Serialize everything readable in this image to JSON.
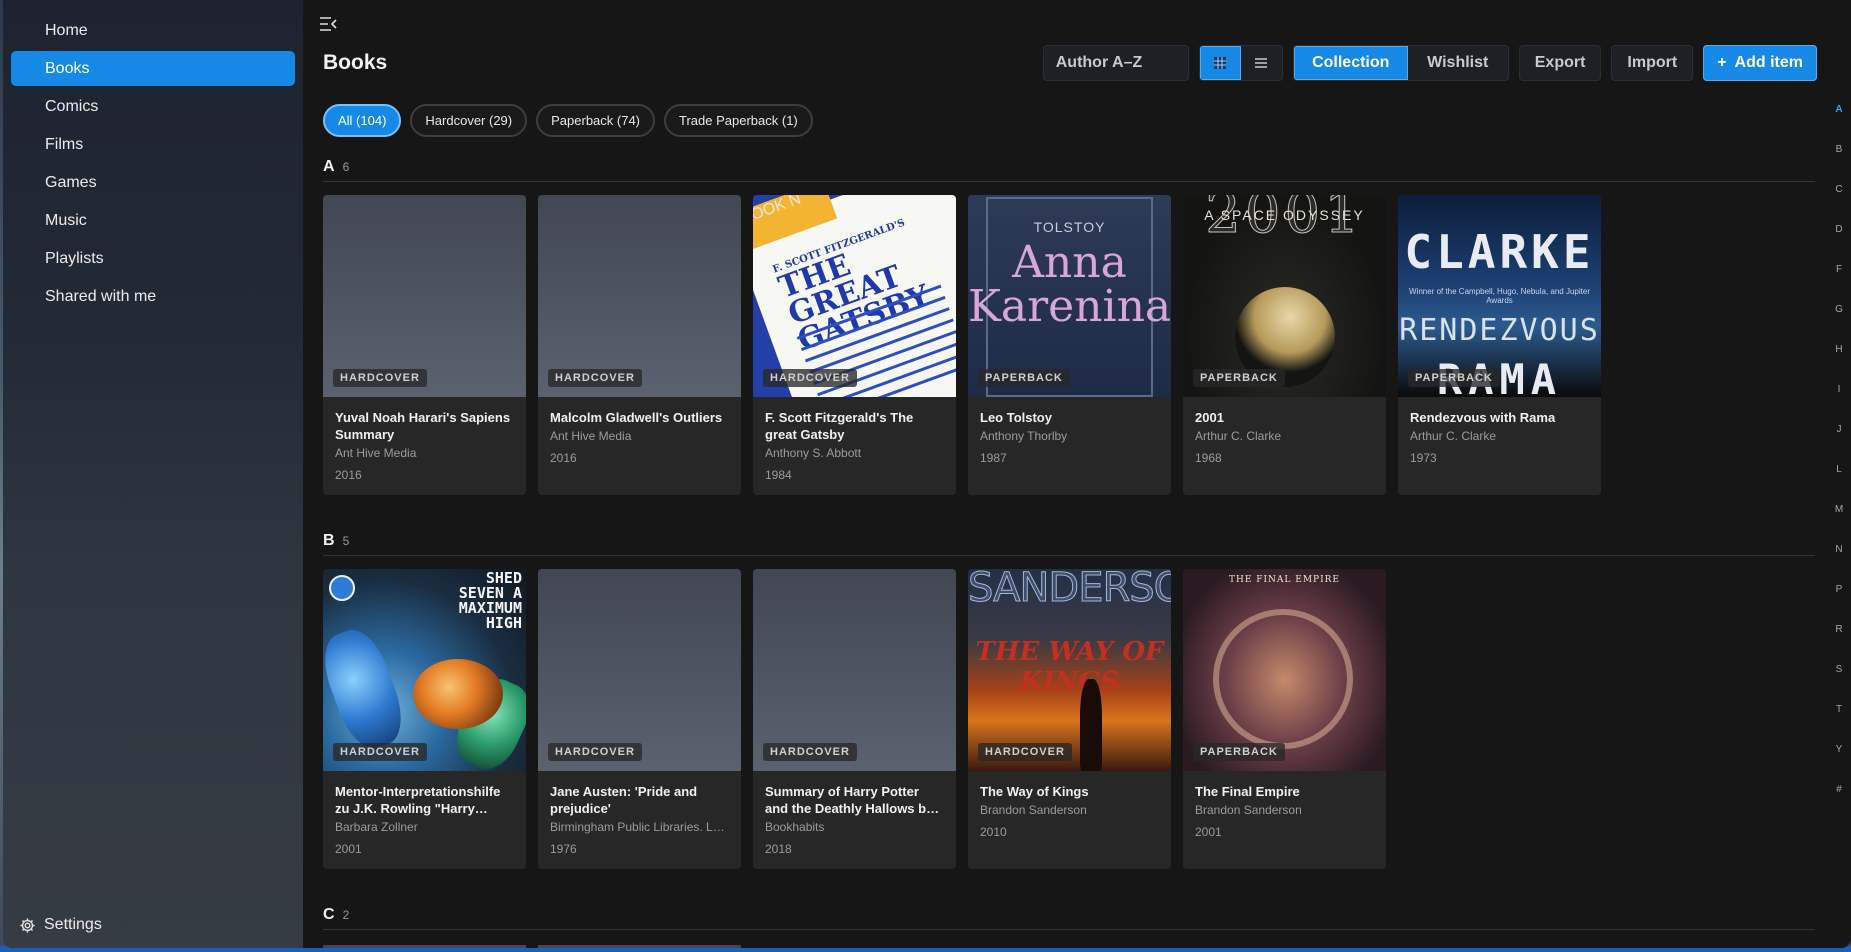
{
  "sidebar": {
    "items": [
      {
        "label": "Home"
      },
      {
        "label": "Books",
        "active": true
      },
      {
        "label": "Comics"
      },
      {
        "label": "Films"
      },
      {
        "label": "Games"
      },
      {
        "label": "Music"
      },
      {
        "label": "Playlists"
      },
      {
        "label": "Shared with me"
      }
    ],
    "settings_label": "Settings"
  },
  "header": {
    "title": "Books",
    "sort_value": "Author A–Z",
    "collection_label": "Collection",
    "wishlist_label": "Wishlist",
    "export_label": "Export",
    "import_label": "Import",
    "add_label": "Add item"
  },
  "filters": [
    {
      "label": "All (104)",
      "active": true
    },
    {
      "label": "Hardcover (29)"
    },
    {
      "label": "Paperback (74)"
    },
    {
      "label": "Trade Paperback (1)"
    }
  ],
  "sections": [
    {
      "letter": "A",
      "count": "6",
      "books": [
        {
          "title": "Yuval Noah Harari's Sapiens Summary",
          "author": "Ant Hive Media",
          "year": "2016",
          "format": "HARDCOVER",
          "cover": "placeholder"
        },
        {
          "title": "Malcolm Gladwell's Outliers",
          "author": "Ant Hive Media",
          "year": "2016",
          "format": "HARDCOVER",
          "cover": "placeholder"
        },
        {
          "title": "F. Scott Fitzgerald's The great Gatsby",
          "author": "Anthony S. Abbott",
          "year": "1984",
          "format": "HARDCOVER",
          "cover": "gatsby"
        },
        {
          "title": "Leo Tolstoy",
          "author": "Anthony Thorlby",
          "year": "1987",
          "format": "PAPERBACK",
          "cover": "anna"
        },
        {
          "title": "2001",
          "author": "Arthur C. Clarke",
          "year": "1968",
          "format": "PAPERBACK",
          "cover": "odyssey"
        },
        {
          "title": "Rendezvous with Rama",
          "author": "Arthur C. Clarke",
          "year": "1973",
          "format": "PAPERBACK",
          "cover": "rama"
        }
      ]
    },
    {
      "letter": "B",
      "count": "5",
      "books": [
        {
          "title": "Mentor-Interpretationshilfe zu J.K. Rowling \"Harry Potter\"",
          "author": "Barbara Zollner",
          "year": "2001",
          "format": "HARDCOVER",
          "cover": "shed"
        },
        {
          "title": "Jane Austen: 'Pride and prejudice'",
          "author": "Birmingham Public Libraries. Language and Literature Dept.",
          "year": "1976",
          "format": "HARDCOVER",
          "cover": "placeholder"
        },
        {
          "title": "Summary of Harry Potter and the Deathly Hallows by J.K. Rowling",
          "author": "Bookhabits",
          "year": "2018",
          "format": "HARDCOVER",
          "cover": "placeholder"
        },
        {
          "title": "The Way of Kings",
          "author": "Brandon Sanderson",
          "year": "2010",
          "format": "HARDCOVER",
          "cover": "kings"
        },
        {
          "title": "The Final Empire",
          "author": "Brandon Sanderson",
          "year": "2001",
          "format": "PAPERBACK",
          "cover": "empire"
        }
      ]
    },
    {
      "letter": "C",
      "count": "2",
      "books": []
    }
  ],
  "cover_text": {
    "gatsby": {
      "band": "BOOK N",
      "author": "F. SCOTT FITZGERALD'S",
      "title": "THE GREAT GATSBY"
    },
    "anna": {
      "author": "TOLSTOY",
      "title": "Anna Karenina"
    },
    "odyssey": {
      "year": "2001",
      "subtitle": "A SPACE ODYSSEY"
    },
    "rama": {
      "author": "CLARKE",
      "awards": "Winner of the Campbell, Hugo, Nebula, and Jupiter Awards",
      "line1": "RENDEZVOUS",
      "line2": "RAMA"
    },
    "shed": {
      "text": "SHED SEVEN A MAXIMUM HIGH"
    },
    "kings": {
      "author": "SANDERSON",
      "title": "THE WAY OF KINGS"
    },
    "empire": {
      "title": "THE FINAL EMPIRE"
    }
  },
  "alphabet": [
    "A",
    "B",
    "C",
    "D",
    "F",
    "G",
    "H",
    "I",
    "J",
    "L",
    "M",
    "N",
    "P",
    "R",
    "S",
    "T",
    "Y",
    "#"
  ],
  "alphabet_active": "A",
  "colors": {
    "accent": "#1688e6"
  }
}
